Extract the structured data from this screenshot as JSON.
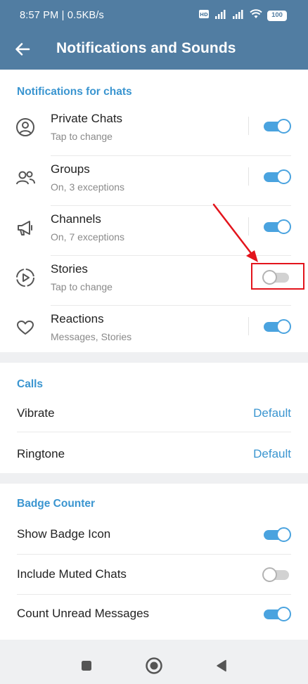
{
  "status_bar": {
    "time": "8:57 PM | 0.5KB/s",
    "battery": "100"
  },
  "app_bar": {
    "title": "Notifications and Sounds"
  },
  "chats_section": {
    "header": "Notifications for chats",
    "items": [
      {
        "title": "Private Chats",
        "subtitle": "Tap to change",
        "icon": "person-circle-icon",
        "enabled": true
      },
      {
        "title": "Groups",
        "subtitle": "On, 3 exceptions",
        "icon": "group-icon",
        "enabled": true
      },
      {
        "title": "Channels",
        "subtitle": "On, 7 exceptions",
        "icon": "megaphone-icon",
        "enabled": true
      },
      {
        "title": "Stories",
        "subtitle": "Tap to change",
        "icon": "stories-play-icon",
        "enabled": false
      },
      {
        "title": "Reactions",
        "subtitle": "Messages, Stories",
        "icon": "heart-icon",
        "enabled": true
      }
    ]
  },
  "calls_section": {
    "header": "Calls",
    "items": [
      {
        "title": "Vibrate",
        "value": "Default"
      },
      {
        "title": "Ringtone",
        "value": "Default"
      }
    ]
  },
  "badge_section": {
    "header": "Badge Counter",
    "items": [
      {
        "title": "Show Badge Icon",
        "enabled": true
      },
      {
        "title": "Include Muted Chats",
        "enabled": false
      },
      {
        "title": "Count Unread Messages",
        "enabled": true
      }
    ]
  },
  "colors": {
    "header_bg": "#517da2",
    "accent": "#3a95d0",
    "toggle_on": "#4aa3df",
    "annotation_red": "#e3141c"
  },
  "nav_bar": {
    "icons": [
      "square-recents-icon",
      "circle-home-icon",
      "triangle-back-icon"
    ]
  }
}
